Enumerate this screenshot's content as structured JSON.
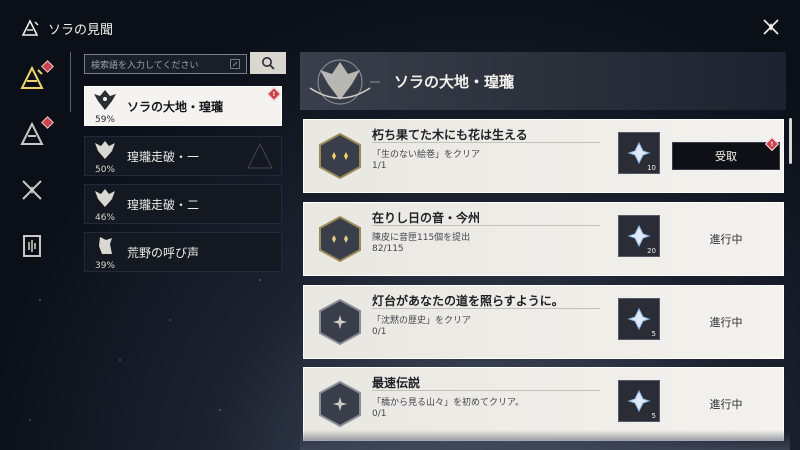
{
  "window": {
    "title": "ソラの見聞"
  },
  "search": {
    "placeholder": "検索語を入力してください"
  },
  "categories": [
    {
      "name": "ソラの大地・瑝瓏",
      "percent": "59%",
      "active": true,
      "alert": "!"
    },
    {
      "name": "瑝瓏走破・一",
      "percent": "50%"
    },
    {
      "name": "瑝瓏走破・二",
      "percent": "46%"
    },
    {
      "name": "荒野の呼び声",
      "percent": "39%"
    }
  ],
  "rail": {
    "alerts": [
      "!",
      "!"
    ]
  },
  "banner": {
    "title": "ソラの大地・瑝瓏"
  },
  "achievements": [
    {
      "title": "朽ち果てた木にも花は生える",
      "description": "「生のない絵巻」をクリア",
      "progress": "1/1",
      "reward_qty": "10",
      "status": "受取",
      "claimable": true,
      "alert": "!"
    },
    {
      "title": "在りし日の音・今州",
      "description": "陳皮に音匣115個を提出",
      "progress": "82/115",
      "reward_qty": "20",
      "status": "進行中"
    },
    {
      "title": "灯台があなたの道を照らすように。",
      "description": "「沈黙の歴史」をクリア",
      "progress": "0/1",
      "reward_qty": "5",
      "status": "進行中"
    },
    {
      "title": "最速伝説",
      "description": "「橋から見る山々」を初めてクリア。",
      "progress": "0/1",
      "reward_qty": "5",
      "status": "進行中"
    }
  ],
  "colors": {
    "alert_red": "#c9424d",
    "card_bg": "#f0efea",
    "claim_bg": "#0e1016"
  }
}
